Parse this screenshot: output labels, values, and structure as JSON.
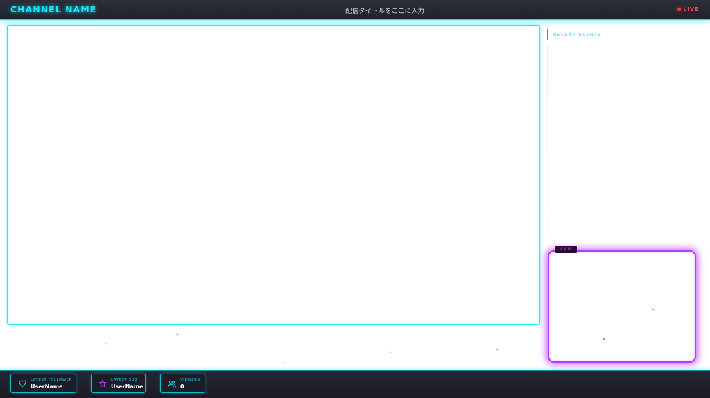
{
  "header": {
    "channel_name": "CHANNEL NAME",
    "stream_title": "配信タイトルをここに入力",
    "live_label": "LIVE"
  },
  "sidebar": {
    "events_title": "RECENT EVENTS"
  },
  "cam": {
    "label": "CAM"
  },
  "footer": {
    "stats": [
      {
        "label": "LATEST FOLLOWER",
        "value": "UserName",
        "icon": "heart-icon"
      },
      {
        "label": "LATEST SUB",
        "value": "UserName",
        "icon": "star-icon"
      },
      {
        "label": "VIEWERS",
        "value": "0",
        "icon": "users-icon"
      }
    ]
  },
  "colors": {
    "accent_cyan": "#00e5ff",
    "accent_magenta": "#b43cff",
    "live_red": "#ff3344",
    "bar_bg": "#20222b"
  }
}
